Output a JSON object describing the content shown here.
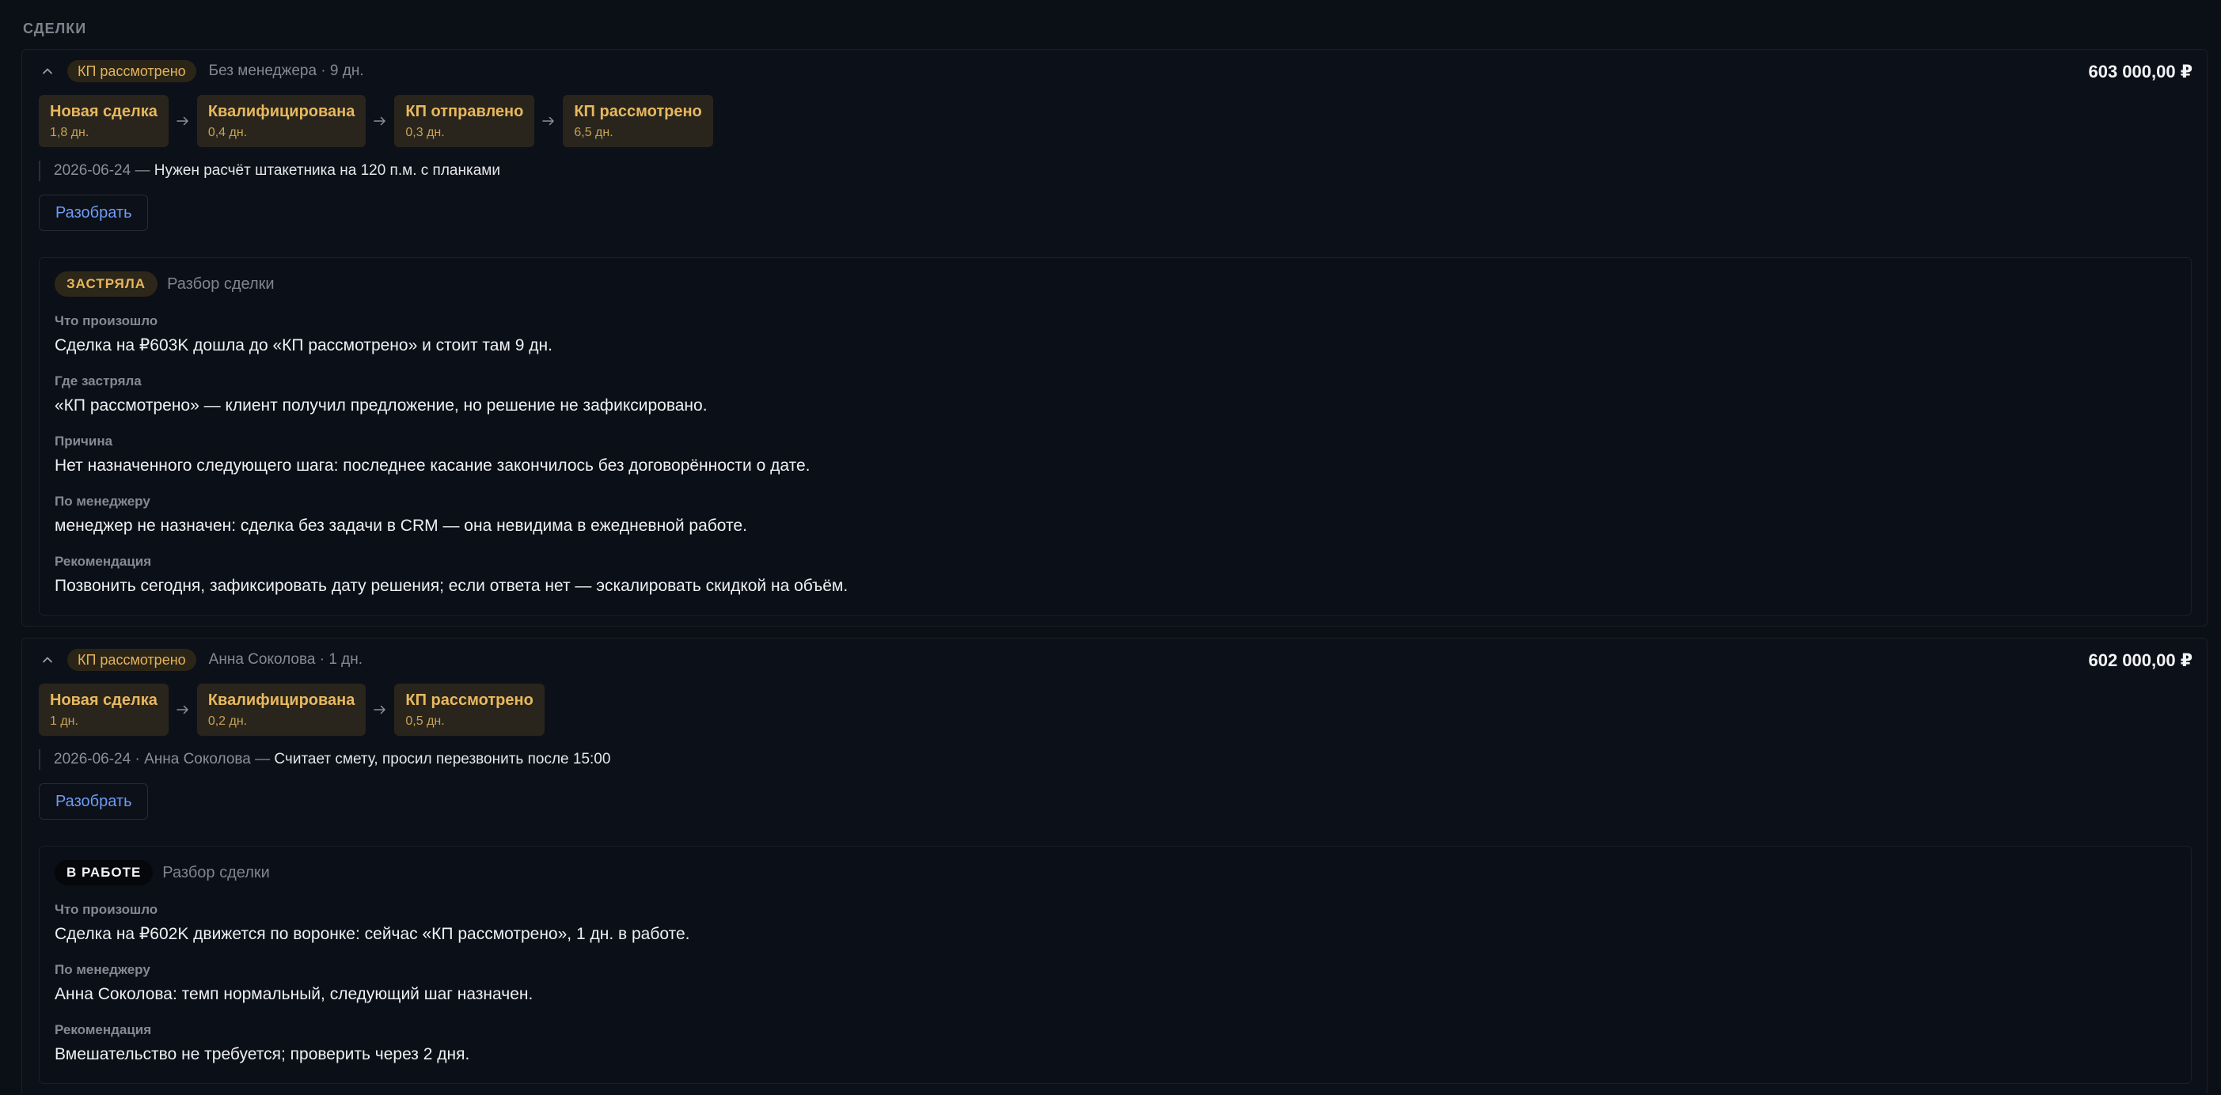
{
  "section": {
    "title": "СДЕЛКИ"
  },
  "deals": [
    {
      "stage": "КП рассмотрено",
      "meta": "Без менеджера · 9 дн.",
      "amount": "603 000,00 ₽",
      "pipeline": [
        {
          "name": "Новая сделка",
          "duration": "1,8 дн."
        },
        {
          "name": "Квалифицирована",
          "duration": "0,4 дн."
        },
        {
          "name": "КП отправлено",
          "duration": "0,3 дн."
        },
        {
          "name": "КП рассмотрено",
          "duration": "6,5 дн."
        }
      ],
      "note": {
        "prefix": "2026-06-24 — ",
        "text": "Нужен расчёт штакетника на 120 п.м. с планками"
      },
      "analyze_label": "Разобрать",
      "analysis": {
        "badge": "ЗАСТРЯЛА",
        "title": "Разбор сделки",
        "fields": [
          {
            "label": "Что произошло",
            "value": "Сделка на ₽603K дошла до «КП рассмотрено» и стоит там 9 дн."
          },
          {
            "label": "Где застряла",
            "value": "«КП рассмотрено» — клиент получил предложение, но решение не зафиксировано."
          },
          {
            "label": "Причина",
            "value": "Нет назначенного следующего шага: последнее касание закончилось без договорённости о дате."
          },
          {
            "label": "По менеджеру",
            "value": "менеджер не назначен: сделка без задачи в CRM — она невидима в ежедневной работе."
          },
          {
            "label": "Рекомендация",
            "value": "Позвонить сегодня, зафиксировать дату решения; если ответа нет — эскалировать скидкой на объём."
          }
        ]
      }
    },
    {
      "stage": "КП рассмотрено",
      "meta": "Анна Соколова · 1 дн.",
      "amount": "602 000,00 ₽",
      "pipeline": [
        {
          "name": "Новая сделка",
          "duration": "1 дн."
        },
        {
          "name": "Квалифицирована",
          "duration": "0,2 дн."
        },
        {
          "name": "КП рассмотрено",
          "duration": "0,5 дн."
        }
      ],
      "note": {
        "prefix": "2026-06-24 · Анна Соколова — ",
        "text": "Считает смету, просил перезвонить после 15:00"
      },
      "analyze_label": "Разобрать",
      "analysis": {
        "badge": "В РАБОТЕ",
        "title": "Разбор сделки",
        "fields": [
          {
            "label": "Что произошло",
            "value": "Сделка на ₽602K движется по воронке: сейчас «КП рассмотрено», 1 дн. в работе."
          },
          {
            "label": "По менеджеру",
            "value": "Анна Соколова: темп нормальный, следующий шаг назначен."
          },
          {
            "label": "Рекомендация",
            "value": "Вмешательство не требуется; проверить через 2 дня."
          }
        ]
      }
    }
  ],
  "icons": {
    "collapse": "chevron-up-icon",
    "stage_arrow": "arrow-right-icon"
  },
  "colors": {
    "background": "#0b0f16",
    "stage_accent": "#e8b85e",
    "link": "#6f9cf5"
  }
}
